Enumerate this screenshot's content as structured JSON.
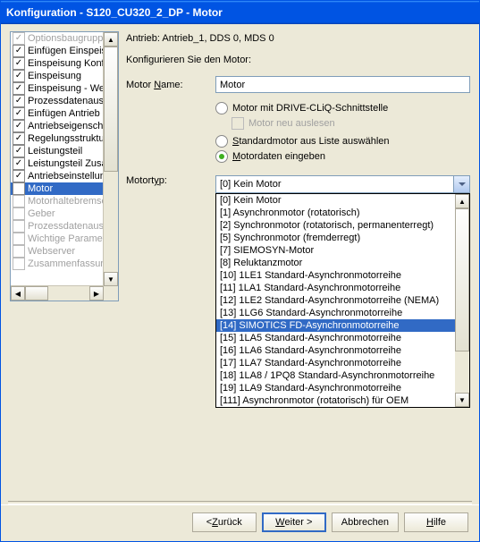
{
  "title": "Konfiguration - S120_CU320_2_DP - Motor",
  "sidebar": {
    "items": [
      {
        "label": "Optionsbaugruppe",
        "checked": true,
        "disabled": true,
        "selected": false
      },
      {
        "label": "Einfügen Einspeisu",
        "checked": true,
        "disabled": false,
        "selected": false
      },
      {
        "label": "Einspeisung Konfig",
        "checked": true,
        "disabled": false,
        "selected": false
      },
      {
        "label": "Einspeisung",
        "checked": true,
        "disabled": false,
        "selected": false
      },
      {
        "label": "Einspeisung - Weite",
        "checked": true,
        "disabled": false,
        "selected": false
      },
      {
        "label": "Prozessdatenausta",
        "checked": true,
        "disabled": false,
        "selected": false
      },
      {
        "label": "Einfügen Antrieb",
        "checked": true,
        "disabled": false,
        "selected": false
      },
      {
        "label": "Antriebseigenschaf",
        "checked": true,
        "disabled": false,
        "selected": false
      },
      {
        "label": "Regelungsstruktur",
        "checked": true,
        "disabled": false,
        "selected": false
      },
      {
        "label": "Leistungsteil",
        "checked": true,
        "disabled": false,
        "selected": false
      },
      {
        "label": "Leistungsteil Zusatz",
        "checked": true,
        "disabled": false,
        "selected": false
      },
      {
        "label": "Antriebseinstellung",
        "checked": true,
        "disabled": false,
        "selected": false
      },
      {
        "label": "Motor",
        "checked": false,
        "disabled": false,
        "selected": true
      },
      {
        "label": "Motorhaltebremse",
        "checked": false,
        "disabled": true,
        "selected": false
      },
      {
        "label": "Geber",
        "checked": false,
        "disabled": true,
        "selected": false
      },
      {
        "label": "Prozessdatenausta",
        "checked": false,
        "disabled": true,
        "selected": false
      },
      {
        "label": "Wichtige Parameter",
        "checked": false,
        "disabled": true,
        "selected": false
      },
      {
        "label": "Webserver",
        "checked": false,
        "disabled": true,
        "selected": false
      },
      {
        "label": "Zusammenfassung",
        "checked": false,
        "disabled": true,
        "selected": false
      }
    ]
  },
  "main": {
    "drive_line": "Antrieb: Antrieb_1, DDS 0, MDS 0",
    "config_label": "Konfigurieren Sie den Motor:",
    "name_label_pre": "Motor ",
    "name_label_u": "N",
    "name_label_post": "ame:",
    "name_value": "Motor",
    "radio": {
      "driveCliq": "Motor mit DRIVE-CLiQ-Schnittstelle",
      "reread_label": "Motor neu auslesen",
      "standard_pre": "",
      "standard_u": "S",
      "standard_post": "tandardmotor aus Liste auswählen",
      "motordaten_pre": "",
      "motordaten_u": "M",
      "motordaten_post": "otordaten eingeben"
    },
    "motortyp_label_pre": "Motort",
    "motortyp_label_u": "y",
    "motortyp_label_post": "p:",
    "combo_value": "[0] Kein Motor",
    "dropdown": [
      {
        "label": "[0] Kein Motor",
        "hl": false
      },
      {
        "label": "[1] Asynchronmotor (rotatorisch)",
        "hl": false
      },
      {
        "label": "[2] Synchronmotor (rotatorisch, permanenterregt)",
        "hl": false
      },
      {
        "label": "[5] Synchronmotor (fremderregt)",
        "hl": false
      },
      {
        "label": "[7] SIEMOSYN-Motor",
        "hl": false
      },
      {
        "label": "[8] Reluktanzmotor",
        "hl": false
      },
      {
        "label": "[10] 1LE1 Standard-Asynchronmotorreihe",
        "hl": false
      },
      {
        "label": "[11] 1LA1 Standard-Asynchronmotorreihe",
        "hl": false
      },
      {
        "label": "[12] 1LE2 Standard-Asynchronmotorreihe (NEMA)",
        "hl": false
      },
      {
        "label": "[13] 1LG6 Standard-Asynchronmotorreihe",
        "hl": false
      },
      {
        "label": "[14] SIMOTICS FD-Asynchronmotorreihe",
        "hl": true
      },
      {
        "label": "[15] 1LA5 Standard-Asynchronmotorreihe",
        "hl": false
      },
      {
        "label": "[16] 1LA6 Standard-Asynchronmotorreihe",
        "hl": false
      },
      {
        "label": "[17] 1LA7 Standard-Asynchronmotorreihe",
        "hl": false
      },
      {
        "label": "[18] 1LA8 / 1PQ8 Standard-Asynchronmotorreihe",
        "hl": false
      },
      {
        "label": "[19] 1LA9 Standard-Asynchronmotorreihe",
        "hl": false
      },
      {
        "label": "[111] Asynchronmotor (rotatorisch) für OEM",
        "hl": false
      }
    ]
  },
  "footer": {
    "back_pre": "< ",
    "back_u": "Z",
    "back_post": "urück",
    "next_u": "W",
    "next_post": "eiter >",
    "cancel": "Abbrechen",
    "help_u": "H",
    "help_post": "ilfe"
  }
}
